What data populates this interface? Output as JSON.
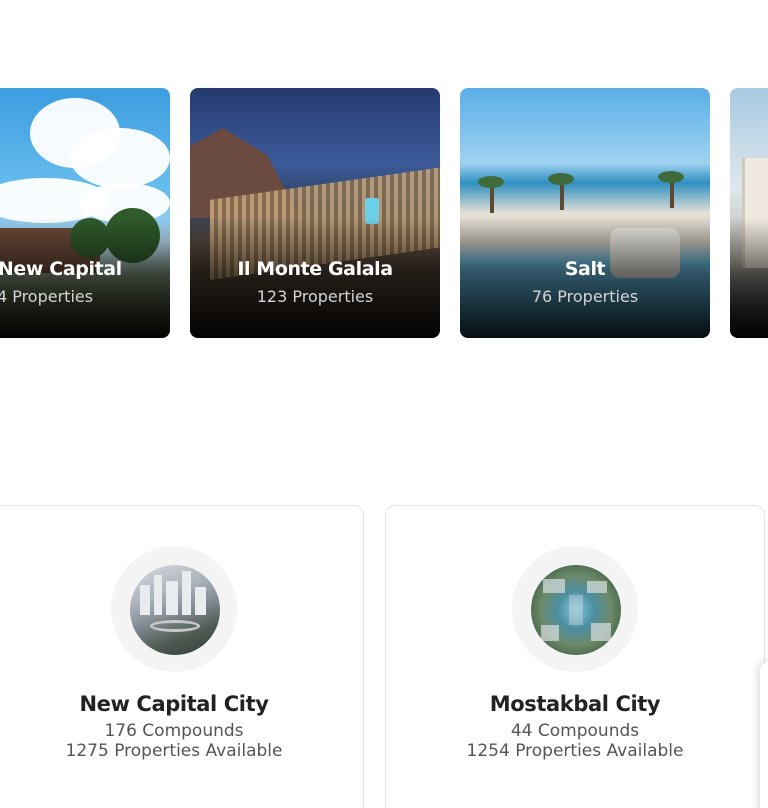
{
  "projects": [
    {
      "name": "co New Capital",
      "count": "4 Properties"
    },
    {
      "name": "Il Monte Galala",
      "count": "123 Properties"
    },
    {
      "name": "Salt",
      "count": "76 Properties"
    },
    {
      "name": "",
      "count": ""
    }
  ],
  "cities": [
    {
      "name": "New Capital City",
      "compounds": "176 Compounds",
      "properties": "1275 Properties Available"
    },
    {
      "name": "Mostakbal City",
      "compounds": "44 Compounds",
      "properties": "1254 Properties Available"
    }
  ]
}
